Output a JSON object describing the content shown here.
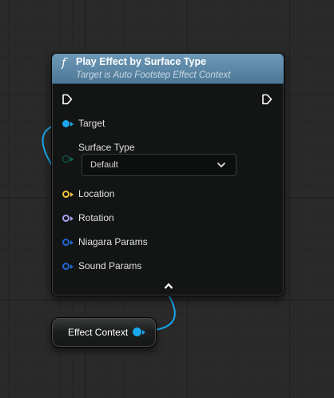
{
  "node": {
    "title": "Play Effect by Surface Type",
    "subtitle": "Target is Auto Footstep Effect Context",
    "function_icon": "f",
    "pins": [
      {
        "label": "Target",
        "color": "#1aa7ec",
        "connected": true
      },
      {
        "label": "Location",
        "color": "#f3c43a",
        "connected": false
      },
      {
        "label": "Rotation",
        "color": "#a7a3f0",
        "connected": false
      },
      {
        "label": "Niagara Params",
        "color": "#1f67d2",
        "connected": false
      },
      {
        "label": "Sound Params",
        "color": "#1f67d2",
        "connected": false
      }
    ],
    "surface_type": {
      "label": "Surface Type",
      "pin_color": "#0f6b5a",
      "selected": "Default"
    }
  },
  "variable_node": {
    "label": "Effect Context",
    "pin_color": "#1aa7ec"
  },
  "colors": {
    "header": "#5b87a6",
    "wire": "#1aa7ec",
    "exec_pin": "#ffffff"
  }
}
